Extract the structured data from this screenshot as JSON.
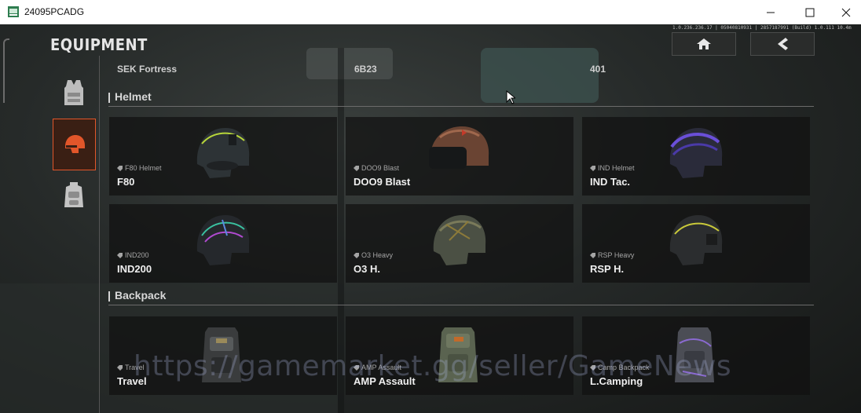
{
  "window": {
    "title": "24095PCADG",
    "minimize_icon": "minimize-icon",
    "maximize_icon": "maximize-icon",
    "close_icon": "close-icon"
  },
  "header": {
    "title": "EQUIPMENT",
    "stats_text": "1.0.236.236.17 | 05040810931 | 2857187991 (Build) 1.0.111 10.4m",
    "home_icon": "home-icon",
    "back_icon": "back-arrow-icon"
  },
  "sidebar": {
    "items": [
      {
        "icon": "vest-icon",
        "active": false
      },
      {
        "icon": "helmet-icon",
        "active": true
      },
      {
        "icon": "backpack-icon",
        "active": false
      }
    ]
  },
  "top_row": [
    {
      "name": "SEK Fortress"
    },
    {
      "name": "6B23"
    },
    {
      "name": "401"
    }
  ],
  "sections": [
    {
      "title": "Helmet",
      "items": [
        {
          "sub": "F80 Helmet",
          "name": "F80",
          "icon": "helmet-f80-icon"
        },
        {
          "sub": "DOO9 Blast",
          "name": "DOO9 Blast",
          "icon": "helmet-blast-icon"
        },
        {
          "sub": "IND Helmet",
          "name": "IND Tac.",
          "icon": "helmet-ind-icon"
        },
        {
          "sub": "IND200",
          "name": "IND200",
          "icon": "helmet-ind200-icon"
        },
        {
          "sub": "O3 Heavy",
          "name": "O3 H.",
          "icon": "helmet-o3-icon"
        },
        {
          "sub": "RSP Heavy",
          "name": "RSP H.",
          "icon": "helmet-rsp-icon"
        }
      ]
    },
    {
      "title": "Backpack",
      "items": [
        {
          "sub": "Travel",
          "name": "Travel",
          "icon": "backpack-travel-icon"
        },
        {
          "sub": "AMP Assault",
          "name": "AMP Assault",
          "icon": "backpack-amp-icon"
        },
        {
          "sub": "Camp Backpack",
          "name": "L.Camping",
          "icon": "backpack-camping-icon"
        }
      ]
    }
  ],
  "watermark": "https://gamemarket.gg/seller/GameNews",
  "colors": {
    "accent": "#e2562a",
    "panel": "#101111"
  }
}
